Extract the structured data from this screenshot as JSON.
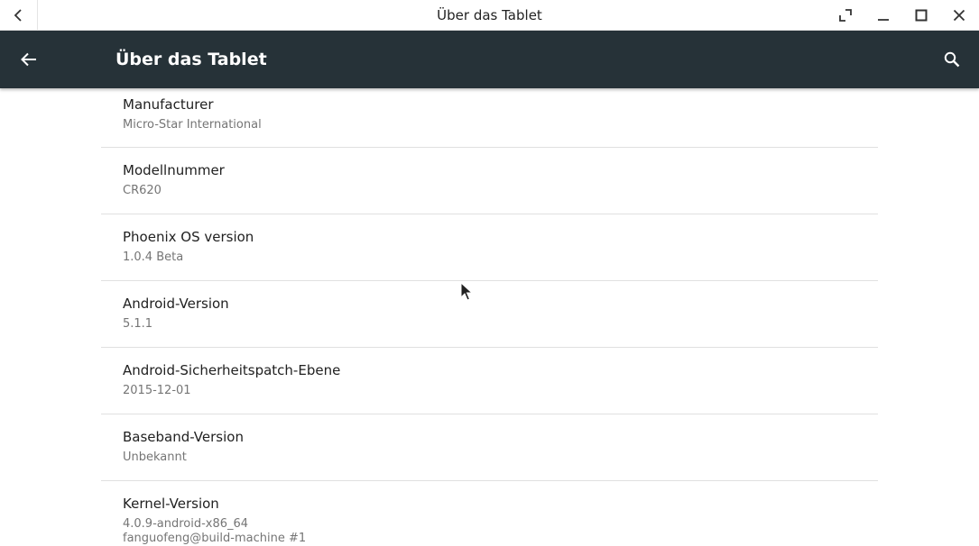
{
  "window": {
    "title": "Über das Tablet"
  },
  "appbar": {
    "title": "Über das Tablet",
    "color": "#263238"
  },
  "items": [
    {
      "title": "Manufacturer",
      "summary": "Micro-Star International"
    },
    {
      "title": "Modellnummer",
      "summary": "CR620"
    },
    {
      "title": "Phoenix OS version",
      "summary": "1.0.4 Beta"
    },
    {
      "title": "Android-Version",
      "summary": "5.1.1"
    },
    {
      "title": "Android-Sicherheitspatch-Ebene",
      "summary": "2015-12-01"
    },
    {
      "title": "Baseband-Version",
      "summary": "Unbekannt"
    },
    {
      "title": "Kernel-Version",
      "summary": "4.0.9-android-x86_64",
      "summary2": "fanguofeng@build-machine #1"
    }
  ]
}
